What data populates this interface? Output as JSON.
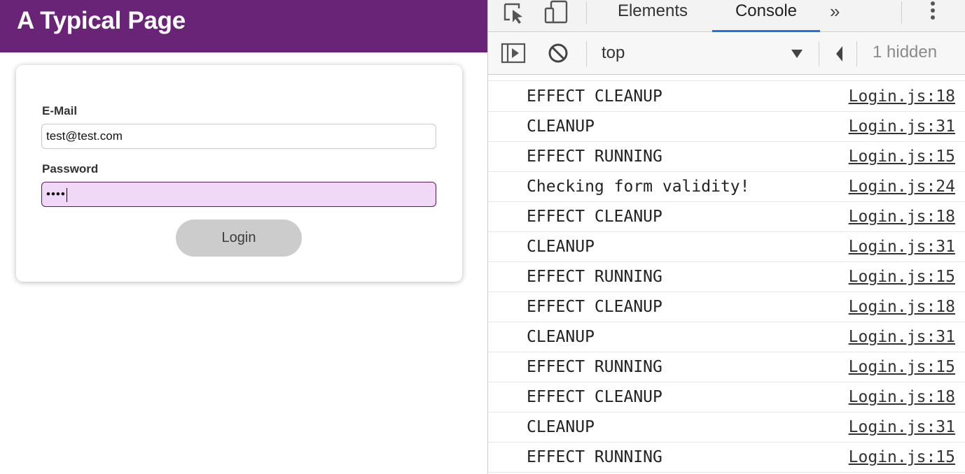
{
  "app": {
    "title": "A Typical Page",
    "header_color": "#692477",
    "form": {
      "email_label": "E-Mail",
      "email_value": "test@test.com",
      "password_label": "Password",
      "password_value": "••••",
      "login_label": "Login"
    }
  },
  "devtools": {
    "tabs": [
      "Elements",
      "Console"
    ],
    "active_tab": "Console",
    "more_tabs_glyph": "»",
    "context": "top",
    "hidden_count_label": "1 hidden",
    "icons": [
      "inspect-element-icon",
      "device-toolbar-icon",
      "more-options-icon",
      "sidebar-toggle-icon",
      "clear-console-icon",
      "dropdown-caret-icon",
      "arrow-left-icon"
    ],
    "accent_color": "#1a73e8",
    "log": [
      {
        "message": "EFFECT CLEANUP",
        "source": "Login.js:18"
      },
      {
        "message": "CLEANUP",
        "source": "Login.js:31"
      },
      {
        "message": "EFFECT RUNNING",
        "source": "Login.js:15"
      },
      {
        "message": "Checking form validity!",
        "source": "Login.js:24"
      },
      {
        "message": "EFFECT CLEANUP",
        "source": "Login.js:18"
      },
      {
        "message": "CLEANUP",
        "source": "Login.js:31"
      },
      {
        "message": "EFFECT RUNNING",
        "source": "Login.js:15"
      },
      {
        "message": "EFFECT CLEANUP",
        "source": "Login.js:18"
      },
      {
        "message": "CLEANUP",
        "source": "Login.js:31"
      },
      {
        "message": "EFFECT RUNNING",
        "source": "Login.js:15"
      },
      {
        "message": "EFFECT CLEANUP",
        "source": "Login.js:18"
      },
      {
        "message": "CLEANUP",
        "source": "Login.js:31"
      },
      {
        "message": "EFFECT RUNNING",
        "source": "Login.js:15"
      }
    ]
  }
}
